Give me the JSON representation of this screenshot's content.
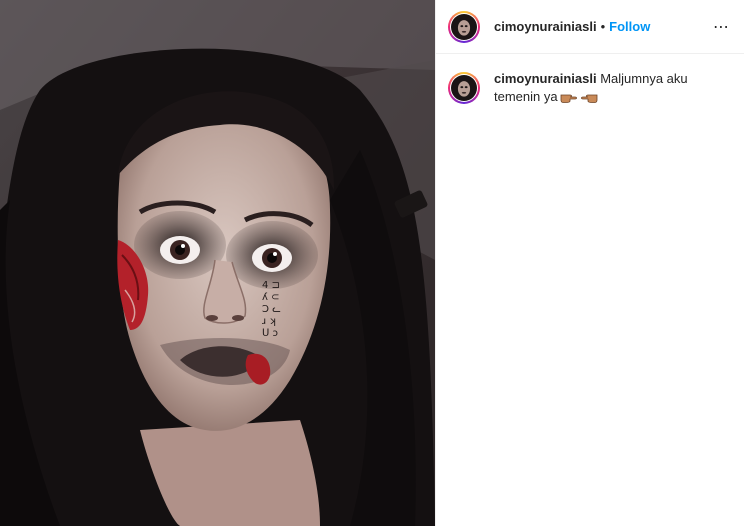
{
  "post": {
    "image_alt": "Selfie of a woman with long black hair wearing horror face makeup",
    "header": {
      "username": "cimoynurainiasli",
      "separator": "•",
      "follow_label": "Follow",
      "more_icon": "⋯"
    },
    "caption": {
      "username": "cimoynurainiasli",
      "text": "Maljumnya aku temenin ya",
      "emojis": [
        "backhand-index-pointing-right",
        "backhand-index-pointing-left"
      ]
    }
  }
}
